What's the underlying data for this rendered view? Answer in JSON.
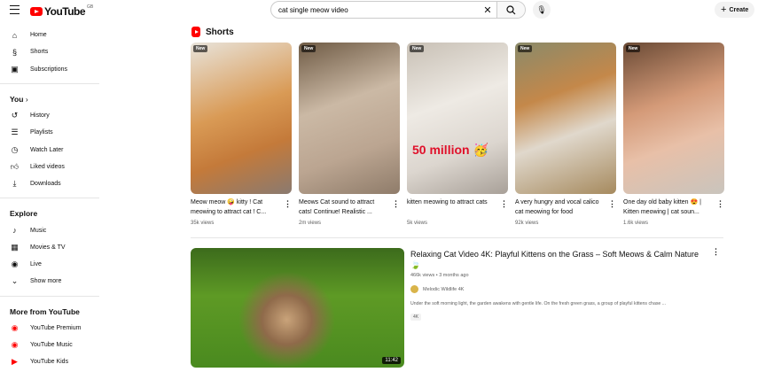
{
  "header": {
    "logo": "YouTube",
    "country": "GB",
    "search_value": "cat single meow video",
    "create_label": "Create"
  },
  "sidebar": {
    "main": [
      {
        "label": "Home",
        "icon": "home-icon"
      },
      {
        "label": "Shorts",
        "icon": "shorts-icon"
      },
      {
        "label": "Subscriptions",
        "icon": "subscriptions-icon"
      }
    ],
    "you_heading": "You",
    "you": [
      {
        "label": "History"
      },
      {
        "label": "Playlists"
      },
      {
        "label": "Watch Later"
      },
      {
        "label": "Liked videos"
      },
      {
        "label": "Downloads"
      }
    ],
    "explore_heading": "Explore",
    "explore": [
      {
        "label": "Music"
      },
      {
        "label": "Movies & TV"
      },
      {
        "label": "Live"
      },
      {
        "label": "Show more"
      }
    ],
    "more_heading": "More from YouTube",
    "more": [
      {
        "label": "YouTube Premium"
      },
      {
        "label": "YouTube Music"
      },
      {
        "label": "YouTube Kids"
      }
    ]
  },
  "shorts": {
    "title": "Shorts",
    "items": [
      {
        "badge": "New",
        "title": "Meow meow 🤪 kitty ! Cat meowing to attract cat ! C...",
        "views": "35k views",
        "overlay": ""
      },
      {
        "badge": "New",
        "title": "Meows Cat sound to attract cats! Continue! Realistic ...",
        "views": "2m views",
        "overlay": ""
      },
      {
        "badge": "New",
        "title": "kitten meowing to attract cats",
        "views": "5k views",
        "overlay": "50 million 🥳"
      },
      {
        "badge": "New",
        "title": "A very hungry and vocal calico cat meowing for food",
        "views": "92k views",
        "overlay": ""
      },
      {
        "badge": "New",
        "title": "One day old baby kitten 😍 | Kitten meowing | cat soun...",
        "views": "1.6k views",
        "overlay": ""
      }
    ]
  },
  "video": {
    "title": "Relaxing Cat Video 4K: Playful Kittens on the Grass – Soft Meows & Calm Nature 🍃",
    "meta": "466k views • 3 months ago",
    "channel": "Melodic Wildlife 4K",
    "description": "Under the soft morning light, the garden awakens with gentle life. On the fresh green grass, a group of playful kittens chase ...",
    "tag": "4K",
    "duration": "11:42"
  }
}
